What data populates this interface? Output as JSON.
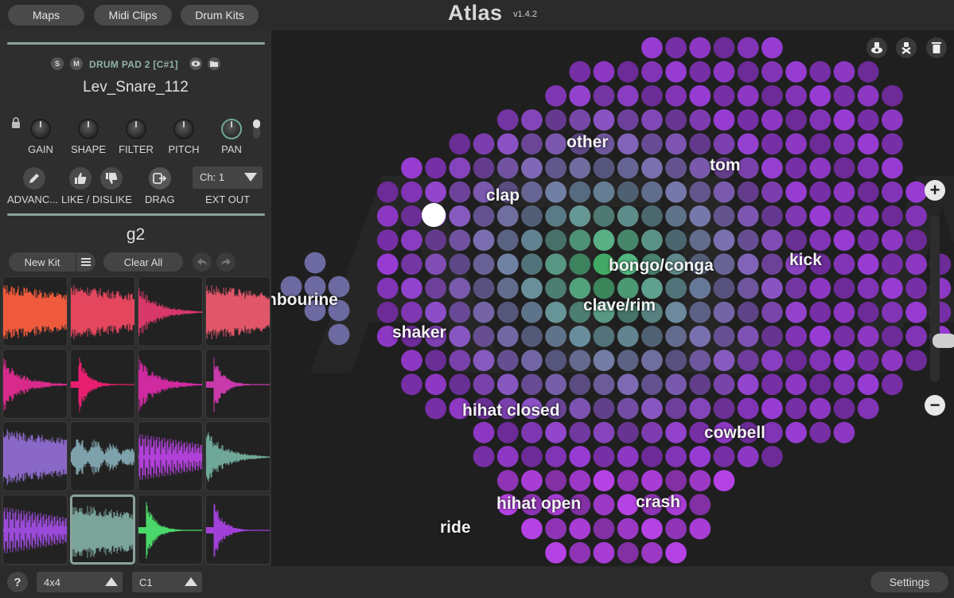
{
  "header": {
    "tabs": [
      "Maps",
      "Midi Clips",
      "Drum Kits"
    ],
    "app_name": "Atlas",
    "version": "v1.4.2"
  },
  "pad_header": {
    "solo": "S",
    "mute": "M",
    "pad_label": "DRUM PAD 2",
    "note": "[C#1]",
    "sample_name": "Lev_Snare_112"
  },
  "knobs": [
    "GAIN",
    "SHAPE",
    "FILTER",
    "PITCH",
    "PAN"
  ],
  "actions": {
    "advanced": "ADVANC...",
    "like_dislike": "LIKE / DISLIKE",
    "drag": "DRAG",
    "ext_out": "EXT OUT",
    "channel": "Ch: 1"
  },
  "kit": {
    "name": "g2",
    "new_kit": "New Kit",
    "clear_all": "Clear All"
  },
  "pads": [
    {
      "color": "#f05a3c",
      "shape": "dense"
    },
    {
      "color": "#e4465e",
      "shape": "dense"
    },
    {
      "color": "#d9386a",
      "shape": "decay"
    },
    {
      "color": "#e2566a",
      "shape": "dense"
    },
    {
      "color": "#d82a8a",
      "shape": "decay"
    },
    {
      "color": "#e81f70",
      "shape": "spike"
    },
    {
      "color": "#cf2aa0",
      "shape": "decay"
    },
    {
      "color": "#c83aaa",
      "shape": "spike"
    },
    {
      "color": "#8a68c8",
      "shape": "dense"
    },
    {
      "color": "#7ea2ac",
      "shape": "noise"
    },
    {
      "color": "#b040d8",
      "shape": "osc"
    },
    {
      "color": "#6fa898",
      "shape": "decay"
    },
    {
      "color": "#9a4ad8",
      "shape": "osc"
    },
    {
      "color": "#7aa39a",
      "shape": "dense"
    },
    {
      "color": "#4ad86a",
      "shape": "spike"
    },
    {
      "color": "#a040d8",
      "shape": "spike"
    }
  ],
  "map": {
    "watermark": "ATLAS",
    "categories": [
      "other",
      "tom",
      "clap",
      "kick",
      "bongo/conga",
      "nbourine",
      "clave/rim",
      "shaker",
      "hihat closed",
      "cowbell",
      "crash",
      "hihat open",
      "ride"
    ]
  },
  "footer": {
    "help": "?",
    "grid_size": "4x4",
    "root_note": "C1",
    "settings": "Settings"
  }
}
